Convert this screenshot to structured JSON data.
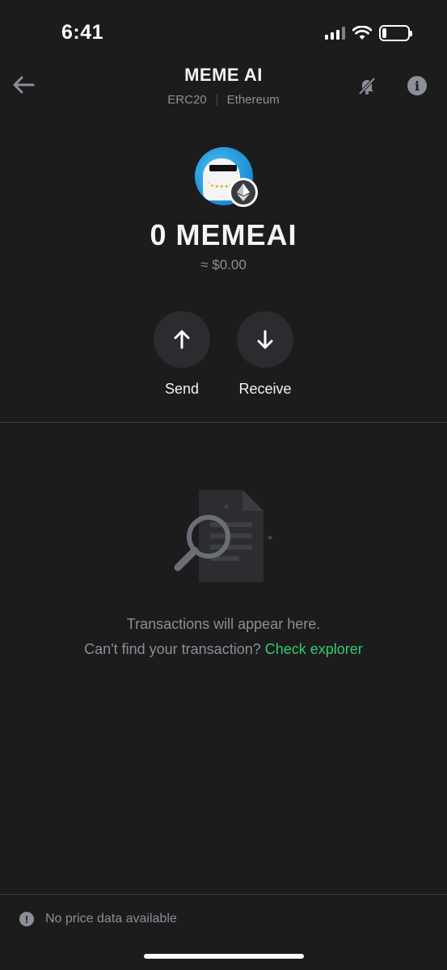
{
  "status_bar": {
    "time": "6:41"
  },
  "header": {
    "title": "MEME AI",
    "standard": "ERC20",
    "network": "Ethereum",
    "back_icon": "arrow-left-icon",
    "notify_icon": "bell-off-icon",
    "info_icon": "info-icon"
  },
  "token": {
    "balance": "0 MEMEAI",
    "fiat_value": "≈ $0.00"
  },
  "actions": {
    "send_label": "Send",
    "receive_label": "Receive"
  },
  "empty_state": {
    "line1": "Transactions will appear here.",
    "line2_prefix": "Can't find your transaction?",
    "link": "Check explorer"
  },
  "footer": {
    "text": "No price data available"
  },
  "colors": {
    "background": "#1c1c1d",
    "accent": "#2ecc71",
    "muted": "#8a8f98"
  }
}
